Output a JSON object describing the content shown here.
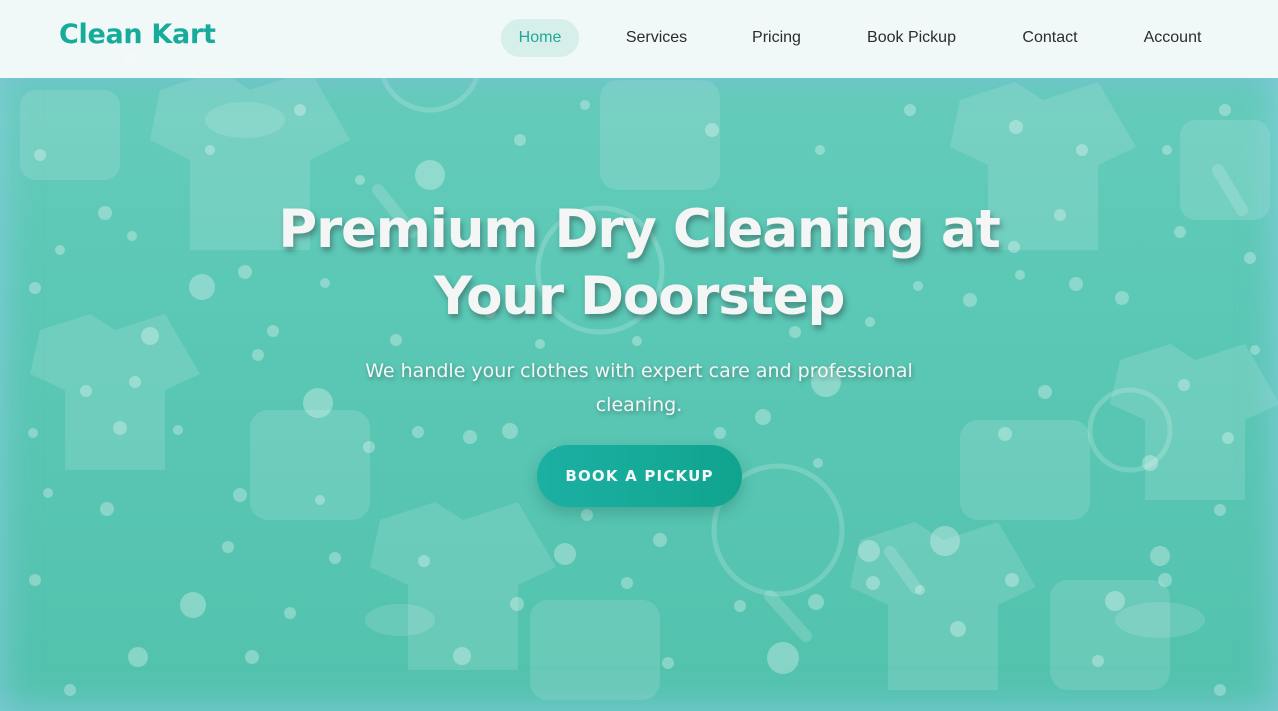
{
  "brand": {
    "name": "Clean Kart"
  },
  "nav": {
    "items": [
      {
        "label": "Home",
        "active": true
      },
      {
        "label": "Services",
        "active": false
      },
      {
        "label": "Pricing",
        "active": false
      },
      {
        "label": "Book Pickup",
        "active": false
      },
      {
        "label": "Contact",
        "active": false
      },
      {
        "label": "Account",
        "active": false
      }
    ]
  },
  "hero": {
    "title_line1": "Premium Dry Cleaning at",
    "title_line2": "Your Doorstep",
    "subtitle_line1": "We handle your clothes with expert care and professional",
    "subtitle_line2": "cleaning.",
    "cta_label": "BOOK A PICKUP"
  },
  "colors": {
    "brand": "#16ab9b",
    "nav_active_bg": "#d6efeb",
    "hero_bg": "#5cc8b6",
    "cta": "#12a895"
  }
}
